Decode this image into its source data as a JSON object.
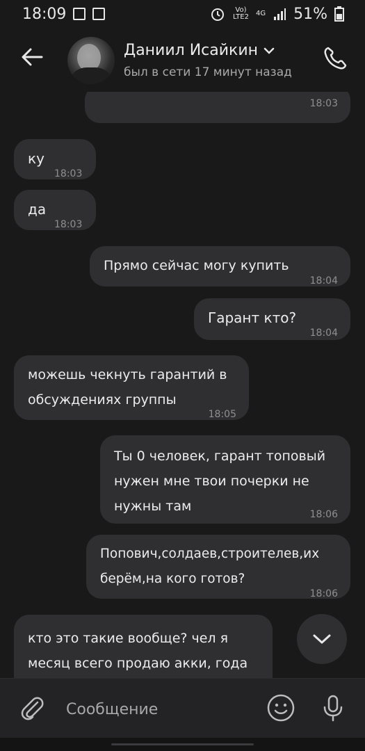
{
  "status_bar": {
    "time": "18:09",
    "network_top": "Vo)",
    "network_bottom": "LTE2",
    "net4g": "4G",
    "battery": "51%"
  },
  "header": {
    "name": "Даниил Исайкин",
    "status": "был в сети 17 минут назад"
  },
  "messages": [
    {
      "side": "out",
      "text": "",
      "time": "18:03"
    },
    {
      "side": "in",
      "text": "ку",
      "time": "18:03"
    },
    {
      "side": "in",
      "text": "да",
      "time": "18:03"
    },
    {
      "side": "out",
      "text": "Прямо сейчас могу купить",
      "time": "18:04"
    },
    {
      "side": "out",
      "text": "Гарант кто?",
      "time": "18:04"
    },
    {
      "side": "in",
      "text": "можешь чекнуть гарантий в\nобсуждениях группы",
      "time": "18:05"
    },
    {
      "side": "out",
      "text": "Ты 0 человек, гарант топовый\nнужен мне твои почерки не\nнужны там",
      "time": "18:06"
    },
    {
      "side": "out",
      "text": "Попович,солдаев,строителев,их\nберём,на кого готов?",
      "time": "18:06"
    },
    {
      "side": "in",
      "text": "кто это такие вообще? чел я\nмесяц всего продаю акки, года",
      "time": ""
    }
  ],
  "composer": {
    "placeholder": "Сообщение"
  },
  "colors": {
    "background": "#19191a",
    "bubble": "#2f2f31",
    "accent_quote": "#4d6a8a"
  },
  "icons": [
    "back-arrow-icon",
    "chevron-down-icon",
    "phone-icon",
    "paperclip-icon",
    "smile-icon",
    "microphone-icon",
    "scroll-down-icon"
  ]
}
